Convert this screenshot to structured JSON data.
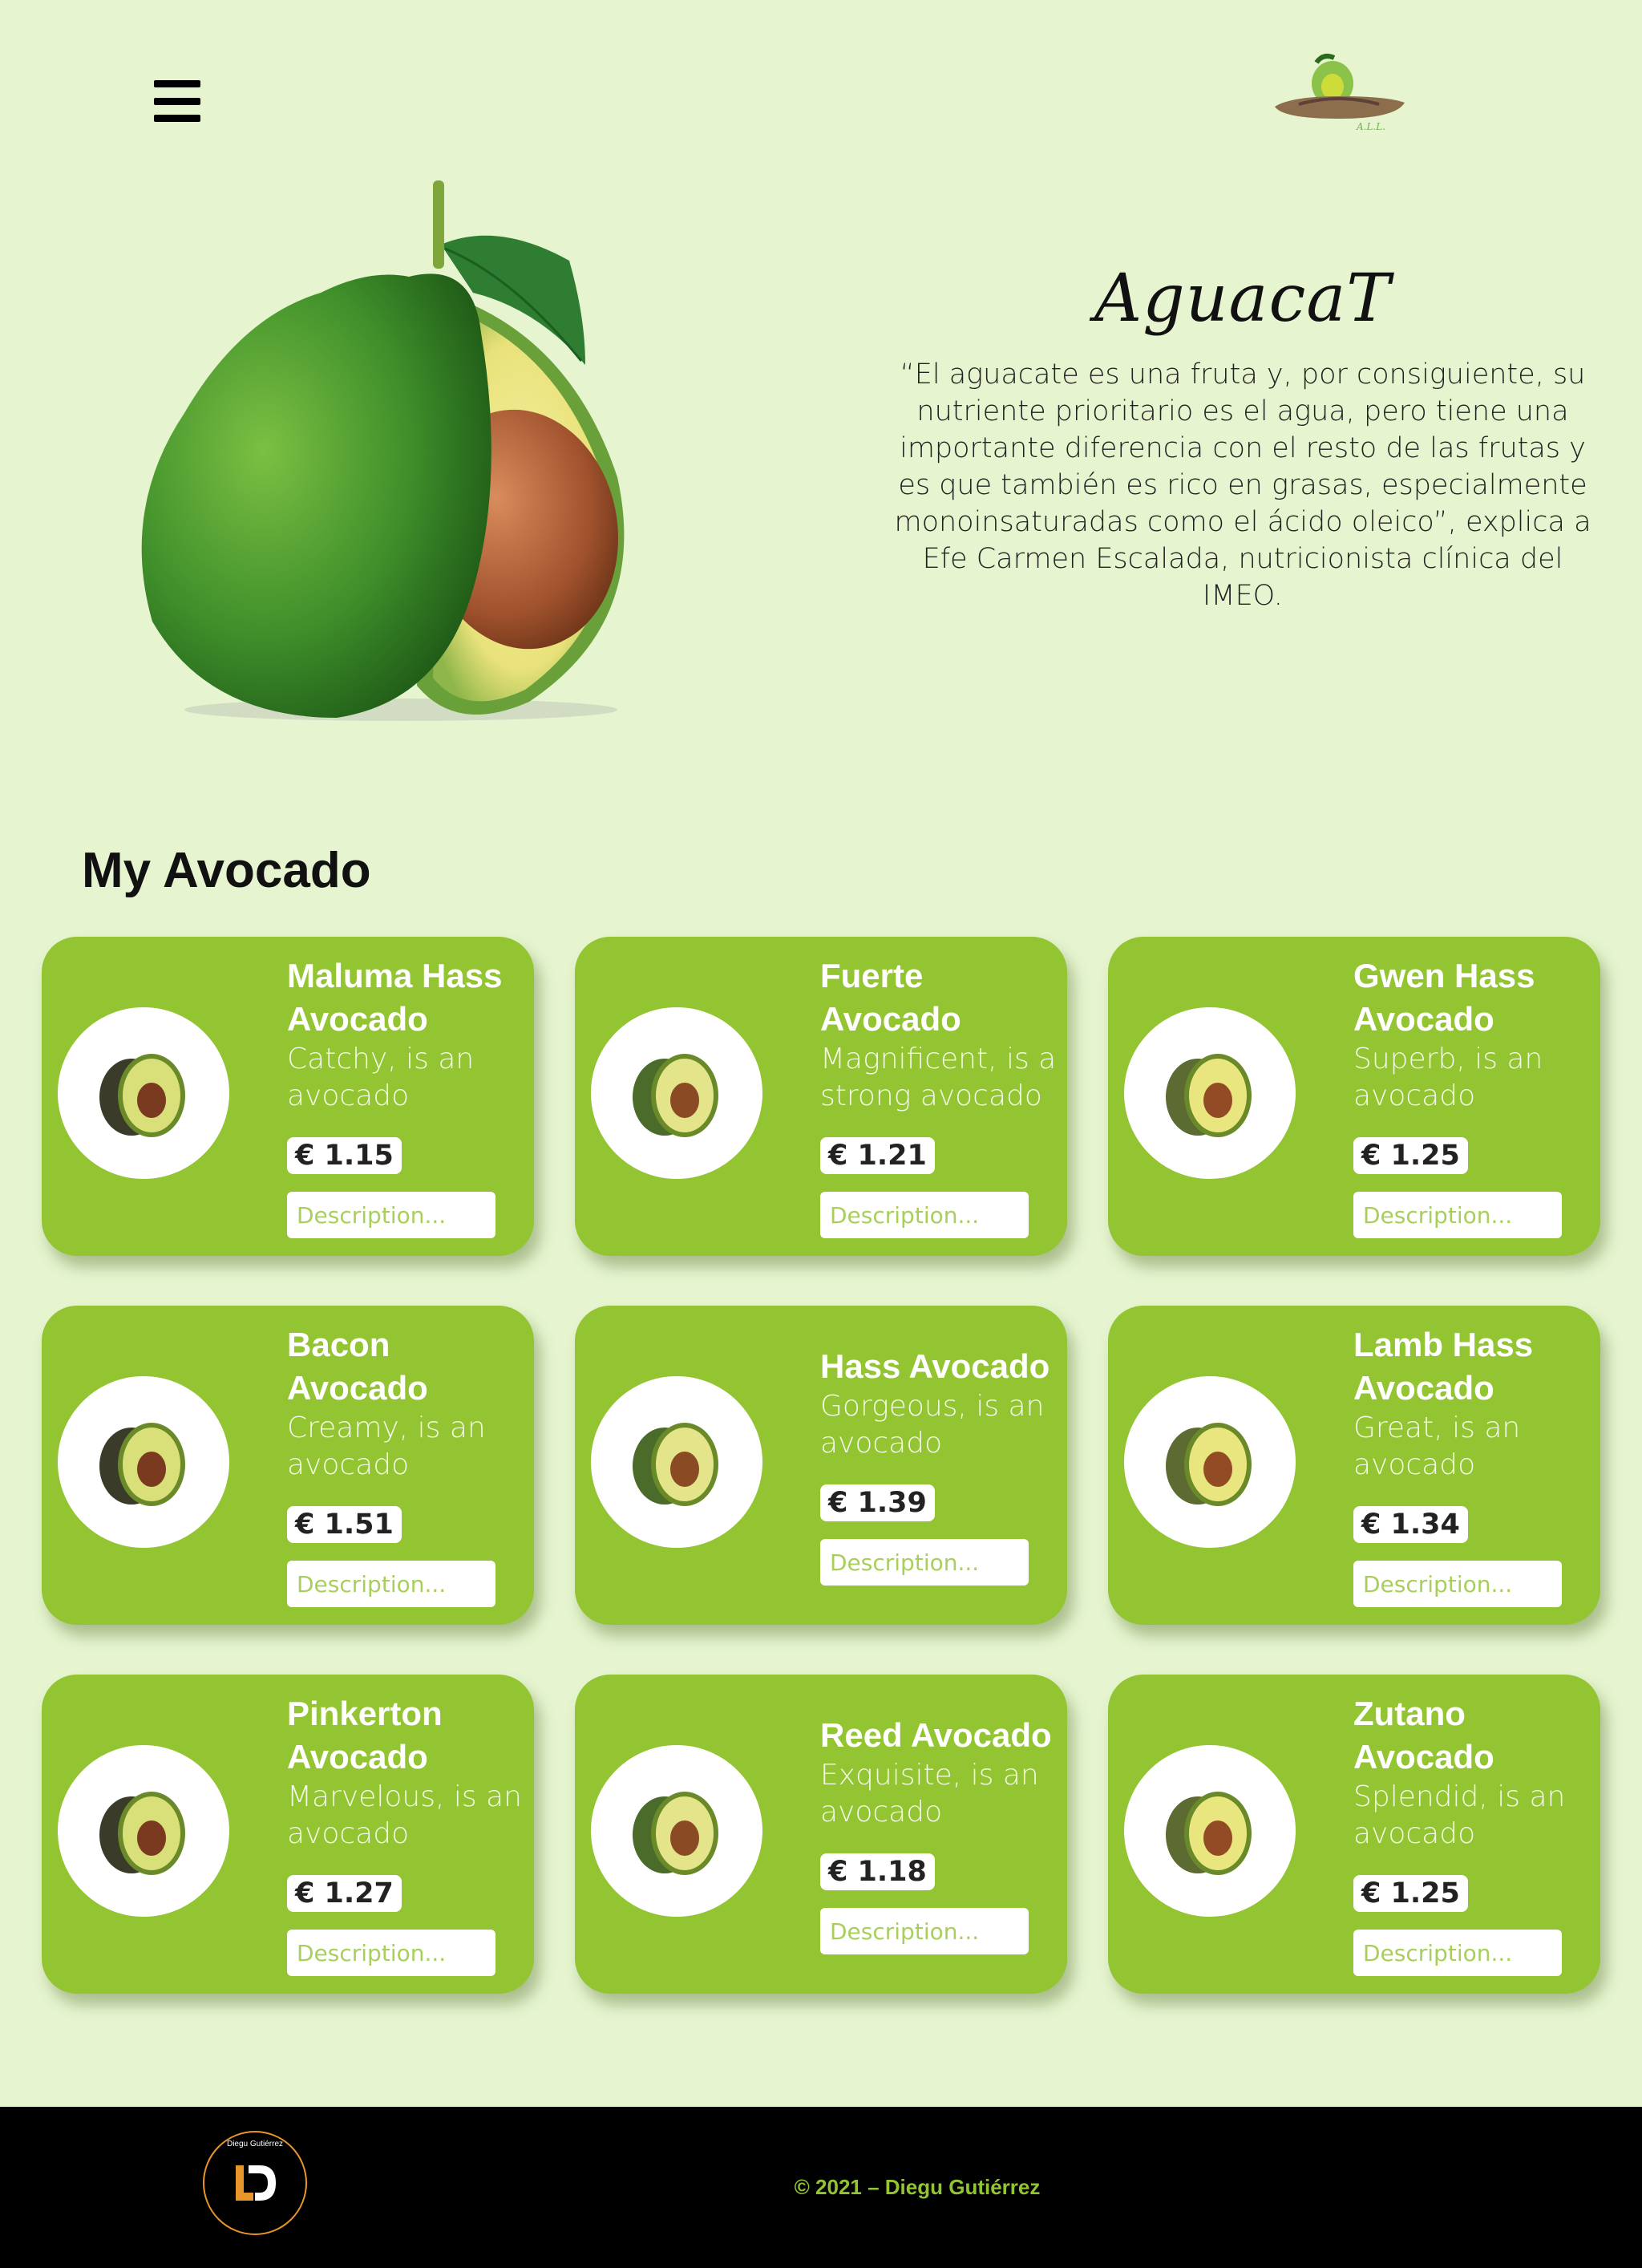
{
  "header": {
    "menu_icon": "hamburger-menu-icon",
    "logo_icon": "avocado-sombrero-logo",
    "logo_text": "A.L.L."
  },
  "hero": {
    "brand": "AguacaT",
    "quote": "“El aguacate es una fruta y, por consiguiente, su nutriente prioritario es el agua, pero tiene una importante diferencia con el resto de las frutas y es que también es rico en grasas, especialmente monoinsaturadas como el ácido oleico”, explica a Efe Carmen Escalada, nutricionista clínica del IMEO."
  },
  "section": {
    "title": "My Avocado"
  },
  "products": [
    {
      "name": "Maluma Hass Avocado",
      "desc": "Catchy, is an avocado",
      "price": "€ 1.15",
      "placeholder": "Description..."
    },
    {
      "name": "Fuerte Avocado",
      "desc": "Magnificent, is a strong avocado",
      "price": "€ 1.21",
      "placeholder": "Description..."
    },
    {
      "name": "Gwen Hass Avocado",
      "desc": "Superb, is an avocado",
      "price": "€ 1.25",
      "placeholder": "Description..."
    },
    {
      "name": "Bacon Avocado",
      "desc": "Creamy, is an avocado",
      "price": "€ 1.51",
      "placeholder": "Description..."
    },
    {
      "name": "Hass Avocado",
      "desc": "Gorgeous, is an avocado",
      "price": "€ 1.39",
      "placeholder": "Description..."
    },
    {
      "name": "Lamb Hass Avocado",
      "desc": "Great, is an avocado",
      "price": "€ 1.34",
      "placeholder": "Description..."
    },
    {
      "name": "Pinkerton Avocado",
      "desc": "Marvelous, is an avocado",
      "price": "€ 1.27",
      "placeholder": "Description..."
    },
    {
      "name": "Reed Avocado",
      "desc": "Exquisite, is an avocado",
      "price": "€ 1.18",
      "placeholder": "Description..."
    },
    {
      "name": "Zutano Avocado",
      "desc": "Splendid, is an avocado",
      "price": "€ 1.25",
      "placeholder": "Description..."
    }
  ],
  "footer": {
    "logo_text": "Diegu Gutiérrez",
    "copyright": "© 2021 – Diegu Gutiérrez"
  },
  "colors": {
    "page_bg": "#e6f5cf",
    "card_bg": "#93c432",
    "footer_bg": "#000000",
    "accent": "#93c432"
  }
}
